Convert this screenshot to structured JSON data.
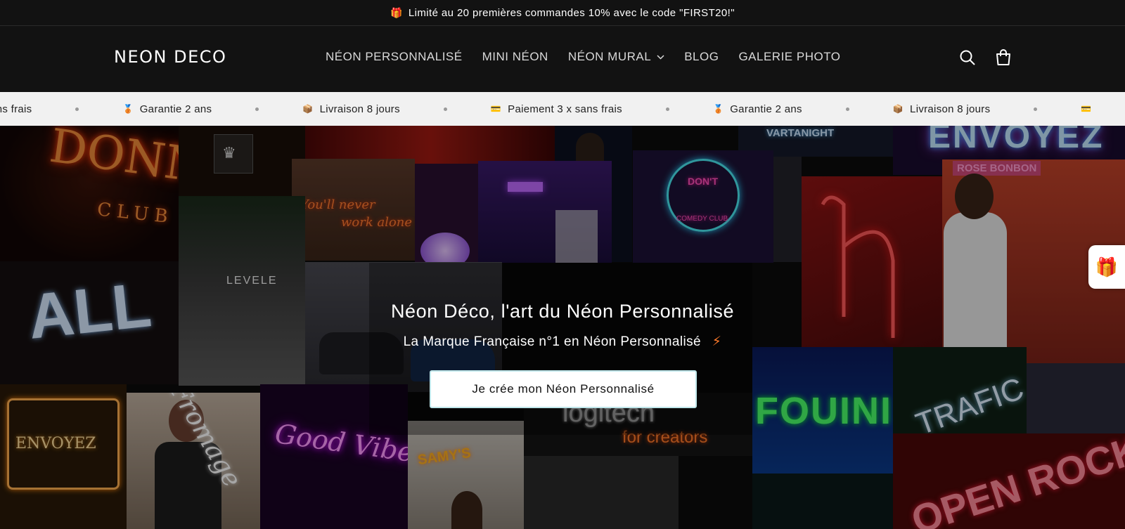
{
  "announcement": {
    "text": "Limité au 20 premières commandes 10% avec le code \"FIRST20!\""
  },
  "header": {
    "logo": "NEON DECO",
    "nav": [
      {
        "label": "NÉON PERSONNALISÉ"
      },
      {
        "label": "MINI NÉON"
      },
      {
        "label": "NÉON MURAL"
      },
      {
        "label": "BLOG"
      },
      {
        "label": "GALERIE PHOTO"
      }
    ]
  },
  "ticker": {
    "items": [
      {
        "icon": "card-icon",
        "label": "x sans frais"
      },
      {
        "icon": "medal-icon",
        "label": "Garantie 2 ans"
      },
      {
        "icon": "box-icon",
        "label": "Livraison 8 jours"
      },
      {
        "icon": "card-icon",
        "label": "Paiement 3 x sans frais"
      },
      {
        "icon": "medal-icon",
        "label": "Garantie 2 ans"
      },
      {
        "icon": "box-icon",
        "label": "Livraison 8 jours"
      }
    ]
  },
  "hero": {
    "title": "Néon Déco, l'art du Néon Personnalisé",
    "subtitle": "La Marque Française n°1 en Néon Personnalisé",
    "cta": "Je crée mon Néon Personnalisé",
    "collage_signs": {
      "donnie": "DONNIE",
      "club": "CLUB",
      "all": "ALL",
      "levele": "LEVELE",
      "never_walk": "You'll never",
      "never_walk_2": "work alone",
      "vartanight": "VARTANIGHT",
      "envoyez_top": "ENVOYEZ",
      "rose_bonbon": "ROSE BONBON",
      "comedy": "DON'T",
      "comedy_2": "COMEDY CLUB",
      "envoyez_left": "ENVOYEZ",
      "fromage": "Fromage",
      "good_vibes": "Good Vibes Only",
      "samys": "SAMY'S",
      "logitech": "logitech",
      "for_creators": "for creators",
      "fouini": "FOUINI",
      "trafic": "TRAFIC",
      "open_rock": "OPEN ROCK"
    }
  },
  "colors": {
    "header_bg": "#121212",
    "ticker_bg": "#f1f1f1",
    "button_bg": "#ffffff",
    "button_border": "#bfe6ea"
  }
}
